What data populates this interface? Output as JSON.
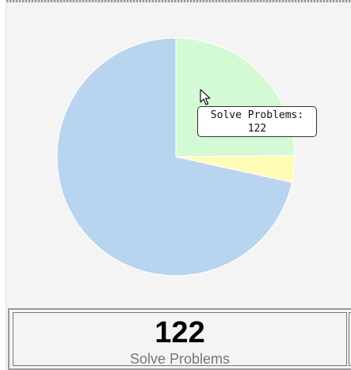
{
  "chart_data": {
    "type": "pie",
    "slices": [
      {
        "value": 122,
        "color": "#d3fad5"
      },
      {
        "value": 18,
        "color": "#fffcb8"
      },
      {
        "value": 352,
        "color": "#b8d4ee"
      }
    ]
  },
  "tooltip": {
    "label": "Solve Problems:",
    "value": "122"
  },
  "stat": {
    "value": "122",
    "label": "Solve Problems"
  },
  "icons": {
    "cursor": "mouse-pointer-icon"
  }
}
